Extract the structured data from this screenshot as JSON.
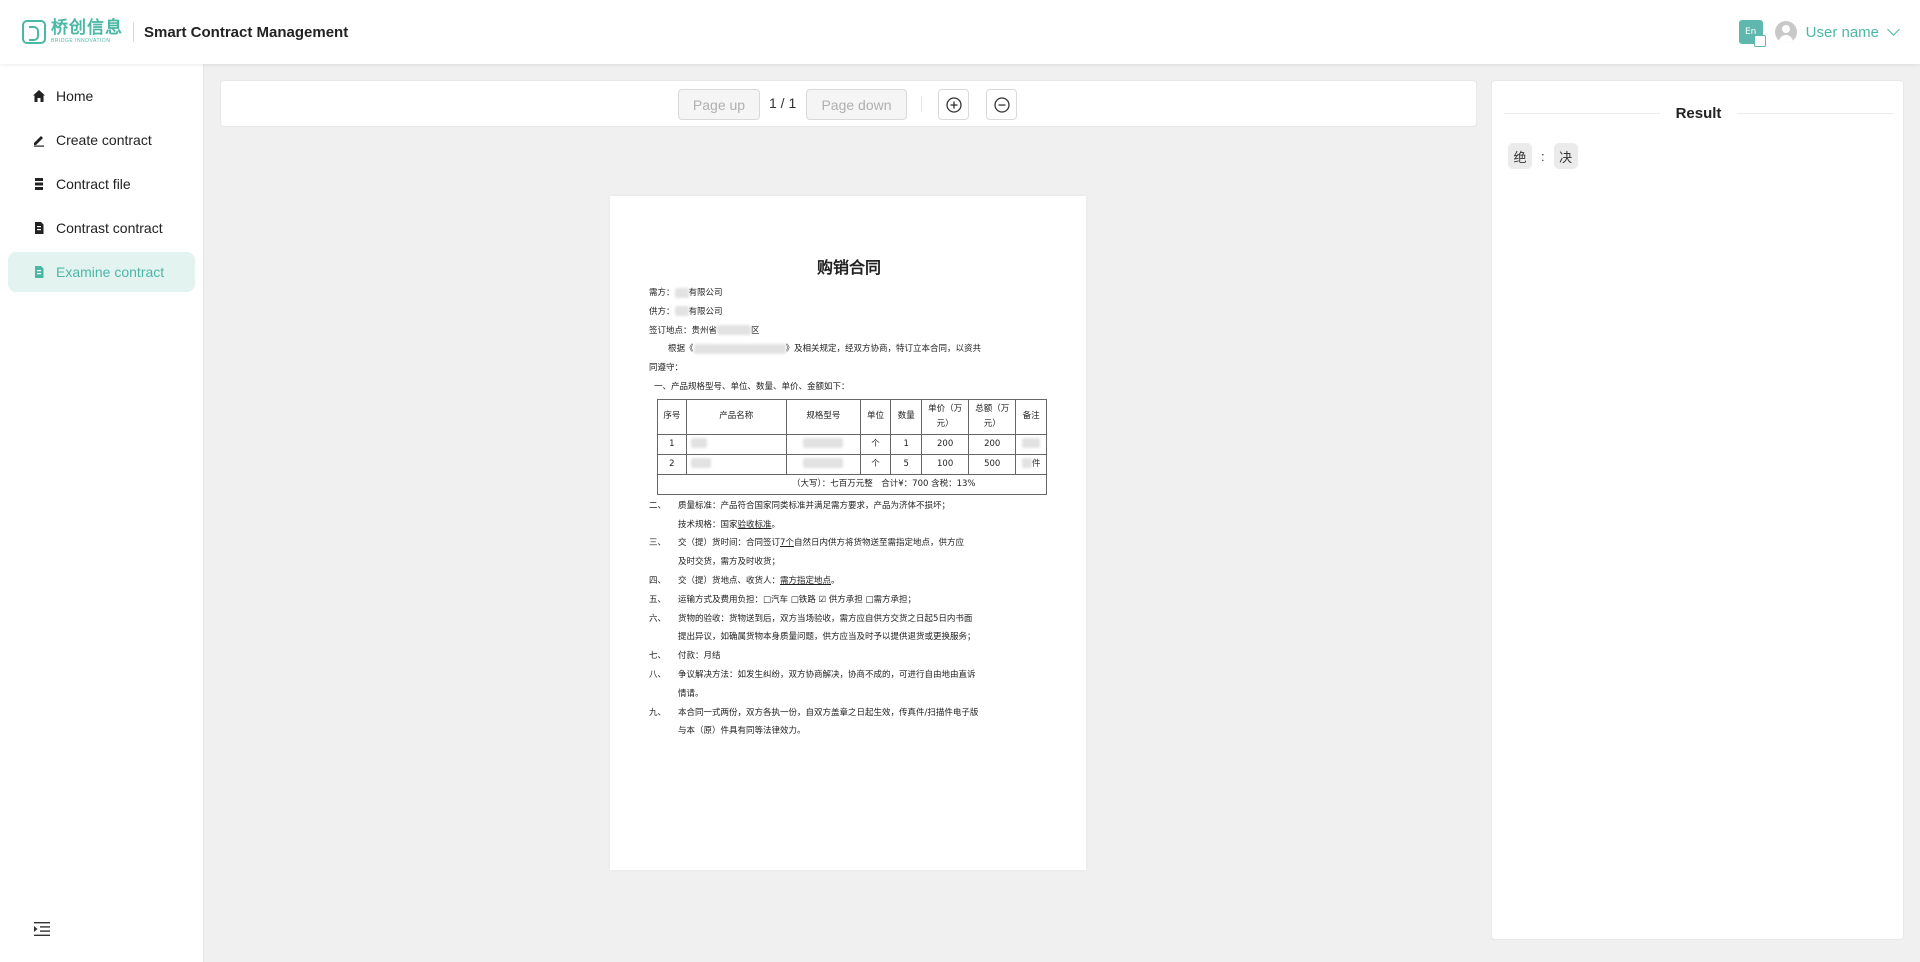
{
  "header": {
    "logo_cn": "桥创信息",
    "logo_en": "BRIDGE INNOVATION",
    "app_title": "Smart Contract Management",
    "translate_icon_text": "En",
    "user_name": "User name"
  },
  "sidebar": {
    "items": [
      {
        "label": "Home",
        "icon": "home-icon"
      },
      {
        "label": "Create contract",
        "icon": "edit-icon"
      },
      {
        "label": "Contract file",
        "icon": "file-list-icon"
      },
      {
        "label": "Contrast contract",
        "icon": "compare-doc-icon"
      },
      {
        "label": "Examine contract",
        "icon": "examine-doc-icon",
        "active": true
      }
    ]
  },
  "toolbar": {
    "page_up": "Page up",
    "page_indicator": "1 / 1",
    "page_down": "Page down"
  },
  "document": {
    "title": "购销合同",
    "lines": {
      "l1": "需方：",
      "l1b": "有限公司",
      "l2": "供方：",
      "l2b": "有限公司",
      "l3": "签订地点：贵州省",
      "l3b": "区",
      "l4a": "根据《",
      "l4b": "》及相关规定，经双方协商，特订立本合同，以资共",
      "l5": "同遵守：",
      "l6": "一、产品规格型号、单位、数量、单价、金额如下："
    },
    "table": {
      "headers": [
        "序号",
        "产品名称",
        "规格型号",
        "单位",
        "数量",
        "单价（万元）",
        "总额（万元）",
        "备注"
      ],
      "rows": [
        [
          "1",
          "",
          "",
          "个",
          "1",
          "200",
          "200",
          ""
        ],
        [
          "2",
          "",
          "",
          "个",
          "5",
          "100",
          "500",
          "件"
        ]
      ],
      "total": "（大写）：七百万元整　合计¥：700 含税：13%"
    },
    "clauses": [
      {
        "n": "二、",
        "t": "质量标准：产品符合国家同类标准并满足需方要求，产品为济体不损坏；"
      },
      {
        "n": "",
        "t": "技术规格：国家",
        "u": "验收标准",
        "after": "。"
      },
      {
        "n": "三、",
        "t": "交（提）货时间：合同签订",
        "u": "7个",
        "after": "自然日内供方将货物送至需指定地点，供方应"
      },
      {
        "n": "",
        "t": "及时交货，需方及时收货；"
      },
      {
        "n": "四、",
        "t": "交（提）货地点、收货人：",
        "u": "需方指定地点",
        "after": "。"
      },
      {
        "n": "五、",
        "t": "运输方式及费用负担：□汽车 □铁路 ☑ 供方承担 □需方承担；"
      },
      {
        "n": "六、",
        "t": "货物的验收：货物送到后，双方当场验收，需方应自供方交货之日起5日内书面"
      },
      {
        "n": "",
        "t": "提出异议，如确属货物本身质量问题，供方应当及时予以提供退货或更换服务；"
      },
      {
        "n": "七、",
        "t": "付款：月结"
      },
      {
        "n": "八、",
        "t": "争议解决方法：如发生纠纷，双方协商解决，协商不成的，可进行自由地由直诉"
      },
      {
        "n": "",
        "t": "情请。"
      },
      {
        "n": "九、",
        "t": "本合同一式两份，双方各执一份，自双方盖章之日起生效，传真件/扫描件电子版"
      },
      {
        "n": "",
        "t": "与本（原）件具有同等法律效力。"
      }
    ]
  },
  "result": {
    "title": "Result",
    "chip_a": "绝",
    "separator": ":",
    "chip_b": "决"
  }
}
